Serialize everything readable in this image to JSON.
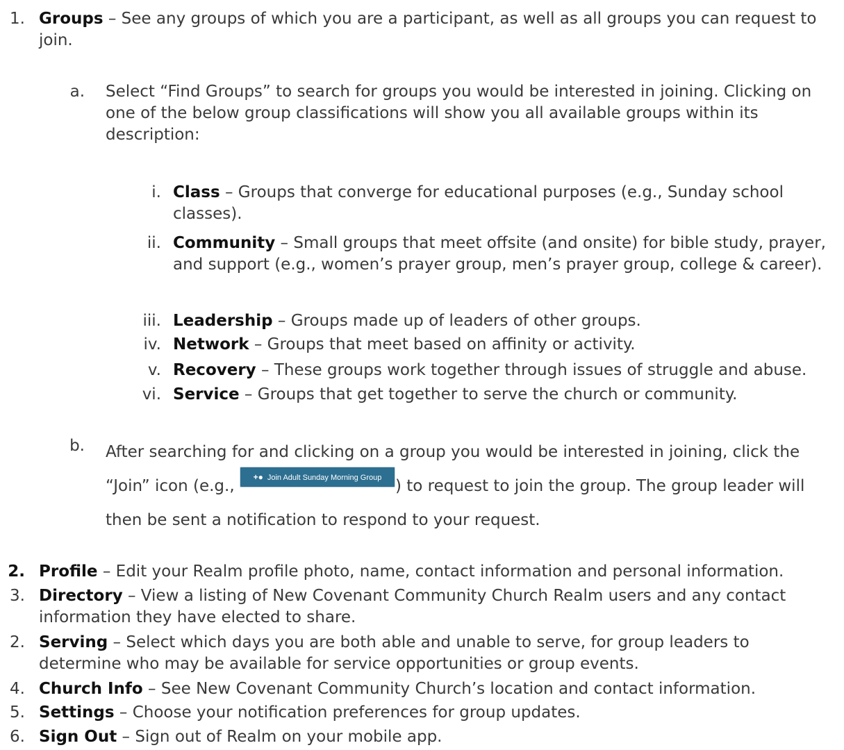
{
  "items": {
    "groups": {
      "num": "1.",
      "title": "Groups",
      "desc": " – See any groups of which you are a participant, as well as all groups you can request to join."
    },
    "find_groups": {
      "num": "a.",
      "text": "Select “Find Groups” to search for groups you would be interested in joining. Clicking on one of the below group classifications will show you all available groups within its description:"
    },
    "classes": [
      {
        "num": "i.",
        "title": "Class",
        "desc": " – Groups that converge for educational purposes (e.g., Sunday school classes)."
      },
      {
        "num": "ii.",
        "title": "Community",
        "desc": " – Small groups that meet offsite (and onsite) for bible study, prayer, and support (e.g., women’s prayer group, men’s prayer group, college & career)."
      },
      {
        "num": "iii.",
        "title": "Leadership",
        "desc": " – Groups made up of leaders of other groups."
      },
      {
        "num": "iv.",
        "title": "Network",
        "desc": " – Groups that meet based on affinity or activity."
      },
      {
        "num": "v.",
        "title": "Recovery",
        "desc": " – These groups work together through issues of struggle and abuse."
      },
      {
        "num": "vi.",
        "title": "Service",
        "desc": " – Groups that get together to serve the church or community."
      }
    ],
    "after_search": {
      "num": "b.",
      "text_before": "After searching for and clicking on a group you would be interested in joining, click the “Join” icon (e.g., ",
      "button_label": "Join Adult Sunday Morning Group",
      "text_after": ") to request to join the group. The group leader will then be sent a notification to respond to your request."
    },
    "profile": {
      "num": "2.",
      "title": "Profile",
      "desc": " – Edit your Realm profile photo, name, contact information and personal information."
    },
    "directory": {
      "num": "3.",
      "title": "Directory",
      "desc": " – View a listing of New Covenant Community Church Realm users and any contact information they have elected to share."
    },
    "serving": {
      "num": "2.",
      "title": "Serving",
      "desc": " – Select which days you are both able and unable to serve, for group leaders to determine who may be available for service opportunities or group events."
    },
    "church_info": {
      "num": "4.",
      "title": "Church Info",
      "desc": " – See New Covenant Community Church’s location and contact information."
    },
    "settings": {
      "num": "5.",
      "title": "Settings",
      "desc": " – Choose your notification preferences for group updates."
    },
    "sign_out": {
      "num": "6.",
      "title": "Sign Out",
      "desc": " – Sign out of Realm on your mobile app."
    }
  },
  "colors": {
    "button_bg": "#2d6f90",
    "text": "#3a3a3a"
  },
  "icons": {
    "join_button_icon": "add-person-icon"
  }
}
